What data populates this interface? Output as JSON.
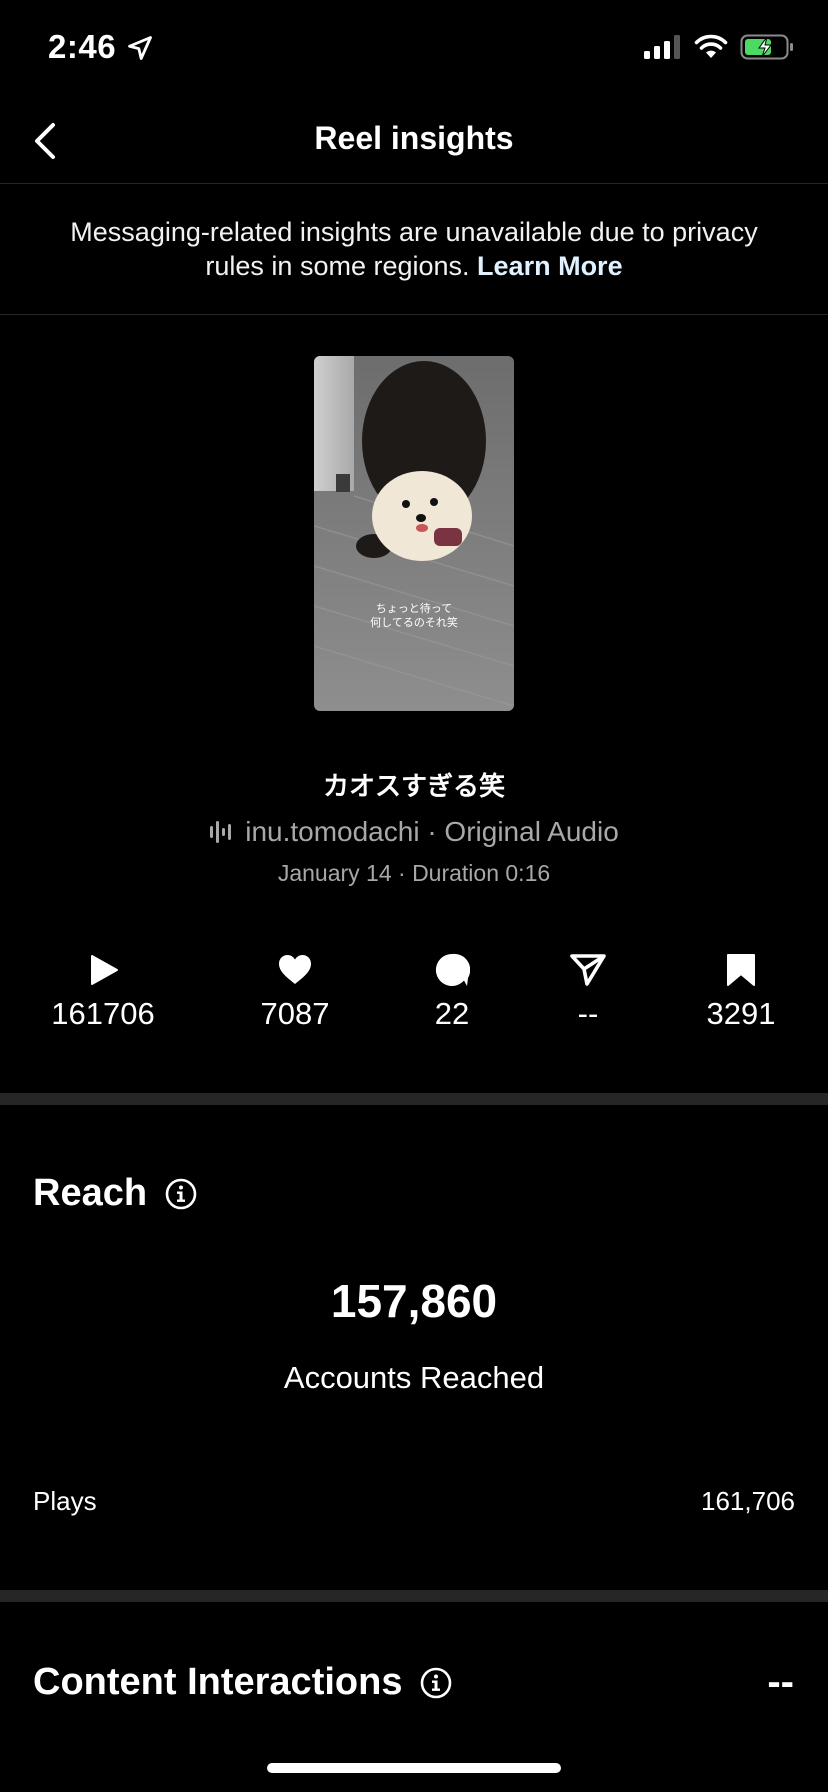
{
  "status_bar": {
    "time": "2:46",
    "icons": [
      "location-arrow-icon",
      "cellular-signal-icon",
      "wifi-icon",
      "battery-charging-icon"
    ]
  },
  "nav": {
    "title": "Reel insights",
    "back_icon": "chevron-left-icon"
  },
  "notice": {
    "text": "Messaging-related insights are unavailable due to privacy rules in some regions.",
    "link": "Learn More"
  },
  "reel": {
    "thumbnail_caption_line1": "ちょっと待って",
    "thumbnail_caption_line2": "何してるのそれ笑",
    "title": "カオスすぎる笑",
    "audio": "inu.tomodachi · Original Audio",
    "date_duration": "January 14 · Duration 0:16"
  },
  "stats": [
    {
      "icon": "play-icon",
      "value": "161706"
    },
    {
      "icon": "heart-icon",
      "value": "7087"
    },
    {
      "icon": "comment-icon",
      "value": "22"
    },
    {
      "icon": "share-icon",
      "value": "--"
    },
    {
      "icon": "bookmark-icon",
      "value": "3291"
    }
  ],
  "reach": {
    "title": "Reach",
    "accounts_reached": "157,860",
    "accounts_reached_label": "Accounts Reached",
    "plays_label": "Plays",
    "plays_value": "161,706"
  },
  "content_interactions": {
    "title": "Content Interactions",
    "value": "--"
  },
  "colors": {
    "background": "#000000",
    "divider": "#262626",
    "muted_text": "#a8a8a8",
    "battery": "#4cd964"
  }
}
